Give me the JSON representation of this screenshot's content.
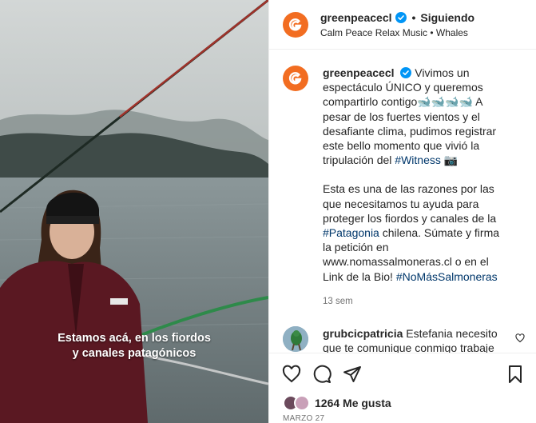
{
  "post": {
    "video_caption_line1": "Estamos acá, en los fiordos",
    "video_caption_line2": "y canales patagónicos",
    "header": {
      "username": "greenpeacecl",
      "separator": "•",
      "follow_state": "Siguiendo",
      "audio": "Calm Peace Relax Music • Whales"
    },
    "caption": {
      "username": "greenpeacecl",
      "p1_text": "Vivimos un espectáculo ÚNICO y queremos compartirlo contigo🐋🐋🐋🐋 A pesar de los fuertes vientos y el desafiante clima, pudimos registrar este bello momento que vivió la tripulación del ",
      "p1_tag": "#Witness",
      "p1_end": " 📷",
      "p2_text": "Esta es una de las razones por las que necesitamos tu ayuda para proteger los fiordos y canales de la ",
      "p2_tag1": "#Patagonia",
      "p2_mid": " chilena. Súmate y firma la petición en www.nomassalmoneras.cl o en el Link de la Bio! ",
      "p2_tag2": "#NoMásSalmoneras",
      "time": "13 sem"
    },
    "comment": {
      "username": "grubcicpatricia",
      "text": "Estefania necesito que te comunique conmigo trabaje en Panart mi kombre es patricia"
    },
    "likes": "1264 Me gusta",
    "date": "MARZO 27"
  },
  "colors": {
    "brand": "#f26d21",
    "link": "#00376b",
    "verified": "#0095f6",
    "muted": "#737373"
  },
  "icons": [
    "greenpeace-logo-icon",
    "verified-icon",
    "heart-icon",
    "comment-icon",
    "share-icon",
    "bookmark-icon",
    "heart-small-icon"
  ]
}
